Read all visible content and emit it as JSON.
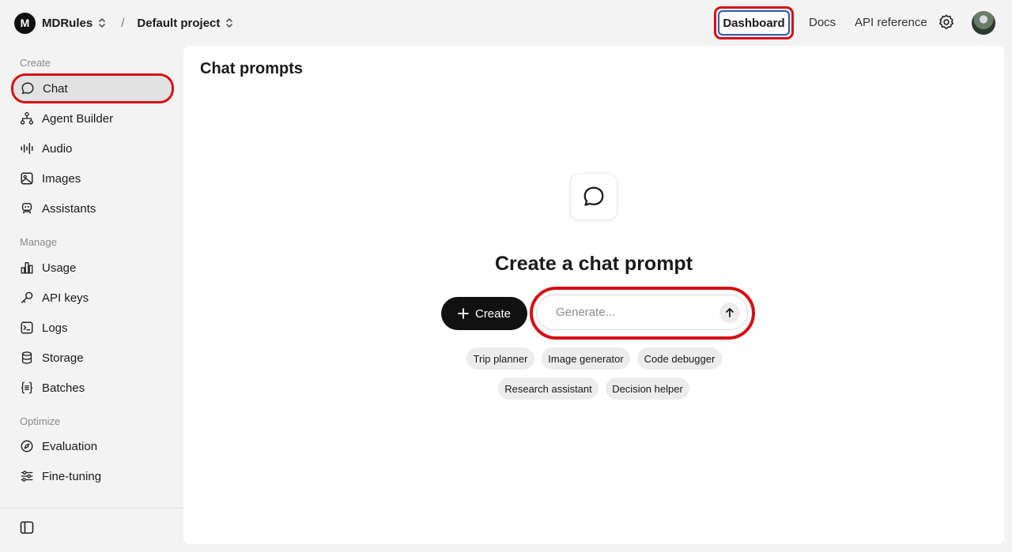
{
  "header": {
    "org_initial": "M",
    "org_name": "MDRules",
    "separator": "/",
    "project_name": "Default project",
    "nav": {
      "dashboard": "Dashboard",
      "docs": "Docs",
      "api_reference": "API reference"
    }
  },
  "sidebar": {
    "sections": {
      "create": "Create",
      "manage": "Manage",
      "optimize": "Optimize"
    },
    "items": [
      {
        "label": "Chat",
        "icon": "chat-bubble-icon"
      },
      {
        "label": "Agent Builder",
        "icon": "agent-builder-icon"
      },
      {
        "label": "Audio",
        "icon": "audio-wave-icon"
      },
      {
        "label": "Images",
        "icon": "image-icon"
      },
      {
        "label": "Assistants",
        "icon": "robot-icon"
      },
      {
        "label": "Usage",
        "icon": "bar-chart-icon"
      },
      {
        "label": "API keys",
        "icon": "key-icon"
      },
      {
        "label": "Logs",
        "icon": "terminal-icon"
      },
      {
        "label": "Storage",
        "icon": "database-icon"
      },
      {
        "label": "Batches",
        "icon": "braces-icon"
      },
      {
        "label": "Evaluation",
        "icon": "compass-icon"
      },
      {
        "label": "Fine-tuning",
        "icon": "sliders-icon"
      }
    ]
  },
  "main": {
    "title": "Chat prompts",
    "empty_title": "Create a chat prompt",
    "create_label": "Create",
    "generate_placeholder": "Generate...",
    "suggestions": [
      "Trip planner",
      "Image generator",
      "Code debugger",
      "Research assistant",
      "Decision helper"
    ]
  },
  "colors": {
    "highlight_red": "#d60f16",
    "dashboard_border": "#2c5aa7"
  }
}
